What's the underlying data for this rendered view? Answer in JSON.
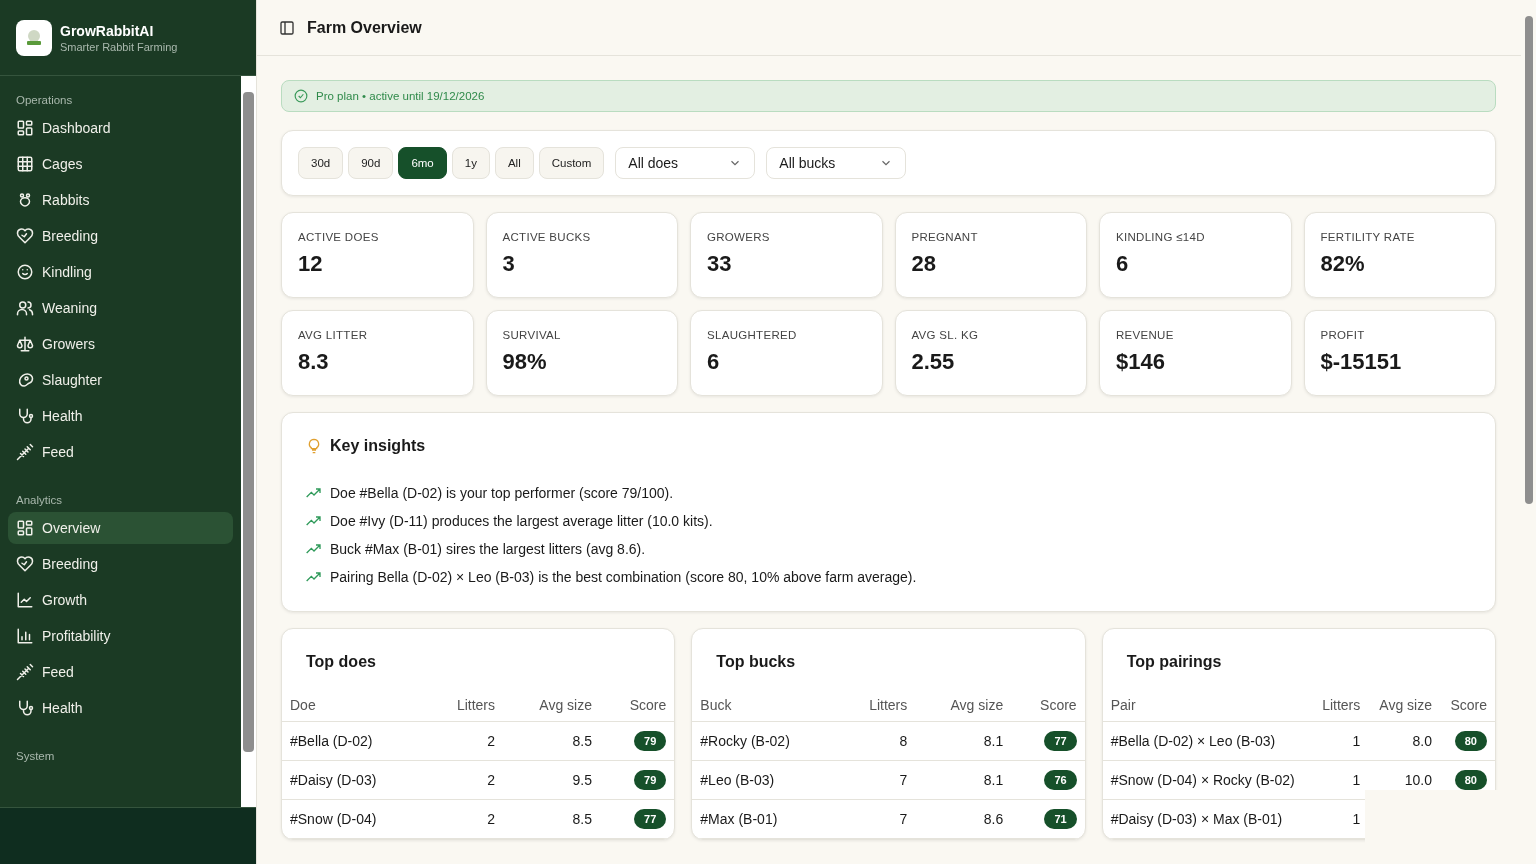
{
  "sidebar": {
    "brand": {
      "name": "GrowRabbitAI",
      "tagline": "Smarter Rabbit Farming"
    },
    "sections": [
      {
        "title": "Operations",
        "items": [
          {
            "label": "Dashboard",
            "selected": false
          },
          {
            "label": "Cages",
            "selected": false
          },
          {
            "label": "Rabbits",
            "selected": false
          },
          {
            "label": "Breeding",
            "selected": false
          },
          {
            "label": "Kindling",
            "selected": false
          },
          {
            "label": "Weaning",
            "selected": false
          },
          {
            "label": "Growers",
            "selected": false
          },
          {
            "label": "Slaughter",
            "selected": false
          },
          {
            "label": "Health",
            "selected": false
          },
          {
            "label": "Feed",
            "selected": false
          }
        ]
      },
      {
        "title": "Analytics",
        "items": [
          {
            "label": "Overview",
            "selected": true
          },
          {
            "label": "Breeding",
            "selected": false
          },
          {
            "label": "Growth",
            "selected": false
          },
          {
            "label": "Profitability",
            "selected": false
          },
          {
            "label": "Feed",
            "selected": false
          },
          {
            "label": "Health",
            "selected": false
          }
        ]
      },
      {
        "title": "System"
      }
    ]
  },
  "header": {
    "title": "Farm Overview"
  },
  "plan_banner": {
    "text": "Pro plan • active until 19/12/2026"
  },
  "filters": {
    "ranges": [
      {
        "label": "30d",
        "selected": false
      },
      {
        "label": "90d",
        "selected": false
      },
      {
        "label": "6mo",
        "selected": true
      },
      {
        "label": "1y",
        "selected": false
      },
      {
        "label": "All",
        "selected": false
      },
      {
        "label": "Custom",
        "selected": false
      }
    ],
    "selects": [
      {
        "value": "All does"
      },
      {
        "value": "All bucks"
      }
    ]
  },
  "stats": [
    {
      "label": "ACTIVE DOES",
      "value": "12"
    },
    {
      "label": "ACTIVE BUCKS",
      "value": "3"
    },
    {
      "label": "GROWERS",
      "value": "33"
    },
    {
      "label": "PREGNANT",
      "value": "28"
    },
    {
      "label": "KINDLING ≤14D",
      "value": "6"
    },
    {
      "label": "FERTILITY RATE",
      "value": "82%"
    },
    {
      "label": "AVG LITTER",
      "value": "8.3"
    },
    {
      "label": "SURVIVAL",
      "value": "98%"
    },
    {
      "label": "SLAUGHTERED",
      "value": "6"
    },
    {
      "label": "AVG SL. KG",
      "value": "2.55"
    },
    {
      "label": "REVENUE",
      "value": "$146"
    },
    {
      "label": "PROFIT",
      "value": "$-15151"
    }
  ],
  "insights": {
    "title": "Key insights",
    "items": [
      "Doe #Bella (D-02) is your top performer (score 79/100).",
      "Doe #Ivy (D-11) produces the largest average litter (10.0 kits).",
      "Buck #Max (B-01) sires the largest litters (avg 8.6).",
      "Pairing Bella (D-02) × Leo (B-03) is the best combination (score 80, 10% above farm average)."
    ]
  },
  "tables": [
    {
      "title": "Top does",
      "columns": [
        "Doe",
        "Litters",
        "Avg size",
        "Score"
      ],
      "rows": [
        {
          "name": "#Bella (D-02)",
          "litters": "2",
          "avg": "8.5",
          "score": "79"
        },
        {
          "name": "#Daisy (D-03)",
          "litters": "2",
          "avg": "9.5",
          "score": "79"
        },
        {
          "name": "#Snow (D-04)",
          "litters": "2",
          "avg": "8.5",
          "score": "77"
        }
      ]
    },
    {
      "title": "Top bucks",
      "columns": [
        "Buck",
        "Litters",
        "Avg size",
        "Score"
      ],
      "rows": [
        {
          "name": "#Rocky (B-02)",
          "litters": "8",
          "avg": "8.1",
          "score": "77"
        },
        {
          "name": "#Leo (B-03)",
          "litters": "7",
          "avg": "8.1",
          "score": "76"
        },
        {
          "name": "#Max (B-01)",
          "litters": "7",
          "avg": "8.6",
          "score": "71"
        }
      ]
    },
    {
      "title": "Top pairings",
      "columns": [
        "Pair",
        "Litters",
        "Avg size",
        "Score"
      ],
      "rows": [
        {
          "name": "#Bella (D-02) × Leo (B-03)",
          "litters": "1",
          "avg": "8.0",
          "score": "80"
        },
        {
          "name": "#Snow (D-04) × Rocky (B-02)",
          "litters": "1",
          "avg": "10.0",
          "score": "80"
        },
        {
          "name": "#Daisy (D-03) × Max (B-01)",
          "litters": "1"
        }
      ]
    }
  ]
}
